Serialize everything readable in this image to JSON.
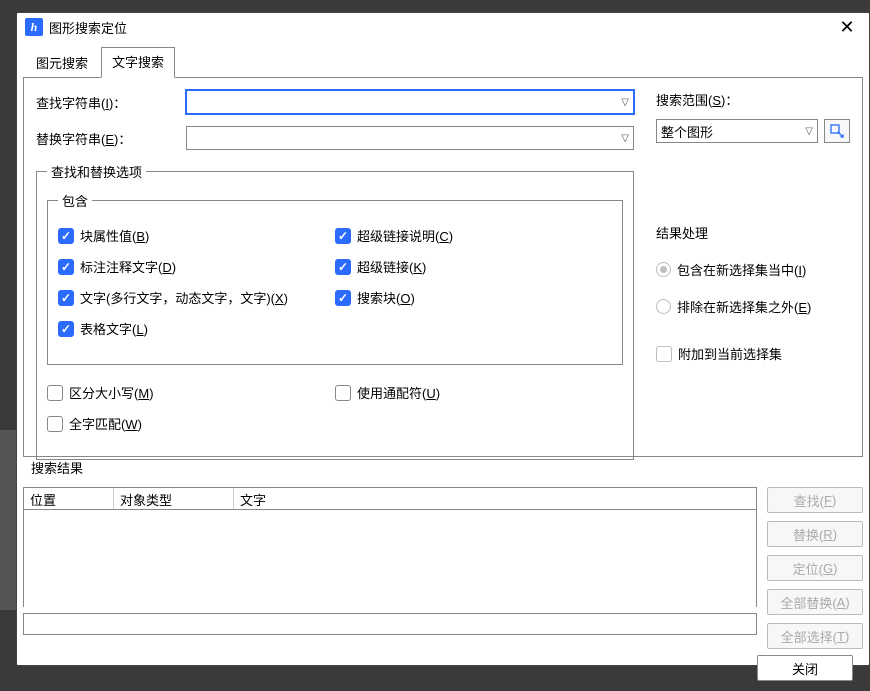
{
  "window": {
    "title": "图形搜索定位"
  },
  "tabs": {
    "element": "图元搜索",
    "text": "文字搜索"
  },
  "find": {
    "label_pre": "查找字符串(",
    "key": "I",
    "label_post": ")：",
    "value": ""
  },
  "replace": {
    "label_pre": "替换字符串(",
    "key": "E",
    "label_post": ")：",
    "value": ""
  },
  "options": {
    "legend": "查找和替换选项",
    "include": {
      "legend": "包含",
      "block_attr": {
        "pre": "块属性值(",
        "key": "B",
        "post": ")",
        "checked": true
      },
      "dim_text": {
        "pre": "标注注释文字(",
        "key": "D",
        "post": ")",
        "checked": true
      },
      "text_multi": {
        "pre": "文字(多行文字，动态文字，文字)(",
        "key": "X",
        "post": ")",
        "checked": true
      },
      "table_text": {
        "pre": "表格文字(",
        "key": "L",
        "post": ")",
        "checked": true
      },
      "hyperlink_desc": {
        "pre": "超级链接说明(",
        "key": "C",
        "post": ")",
        "checked": true
      },
      "hyperlink": {
        "pre": "超级链接(",
        "key": "K",
        "post": ")",
        "checked": true
      },
      "search_block": {
        "pre": "搜索块(",
        "key": "O",
        "post": ")",
        "checked": true
      }
    },
    "case": {
      "pre": "区分大小写(",
      "key": "M",
      "post": ")",
      "checked": false
    },
    "whole": {
      "pre": "全字匹配(",
      "key": "W",
      "post": ")",
      "checked": false
    },
    "wildcard": {
      "pre": "使用通配符(",
      "key": "U",
      "post": ")",
      "checked": false
    }
  },
  "scope": {
    "label_pre": "搜索范围(",
    "key": "S",
    "label_post": ")：",
    "selected": "整个图形"
  },
  "resultsHandling": {
    "legend": "结果处理",
    "opt_include": {
      "pre": "包含在新选择集当中(",
      "key": "I",
      "post": ")",
      "checked": true
    },
    "opt_exclude": {
      "pre": "排除在新选择集之外(",
      "key": "E",
      "post": ")",
      "checked": false
    },
    "opt_append": {
      "label": "附加到当前选择集",
      "checked": false
    }
  },
  "results": {
    "legend": "搜索结果",
    "col_position": "位置",
    "col_type": "对象类型",
    "col_text": "文字",
    "status": ""
  },
  "buttons": {
    "find": {
      "pre": "查找(",
      "key": "F",
      "post": ")"
    },
    "replace": {
      "pre": "替换(",
      "key": "R",
      "post": ")"
    },
    "locate": {
      "pre": "定位(",
      "key": "G",
      "post": ")"
    },
    "replaceAll": {
      "pre": "全部替换(",
      "key": "A",
      "post": ")"
    },
    "selectAll": {
      "pre": "全部选择(",
      "key": "T",
      "post": ")"
    },
    "close": "关闭"
  }
}
